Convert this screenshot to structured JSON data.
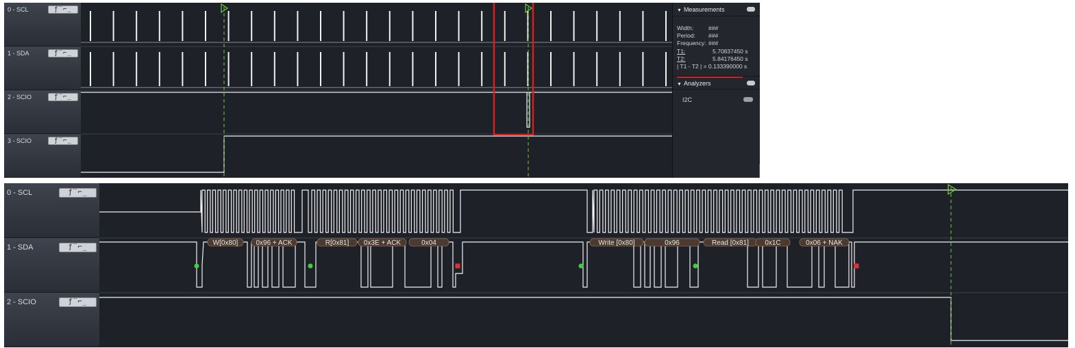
{
  "top": {
    "channels": [
      {
        "name": "0 - SCL",
        "controls": "ƒ‾⌐_"
      },
      {
        "name": "1 - SDA",
        "controls": "ƒ‾⌐_"
      },
      {
        "name": "2 - SCIO",
        "controls": "ƒ‾⌐_"
      },
      {
        "name": "3 - SCIO",
        "controls": "ƒ‾⌐_"
      }
    ]
  },
  "measurements": {
    "title": "Measurements",
    "rows": [
      {
        "key": "Width:",
        "value": "###"
      },
      {
        "key": "Period:",
        "value": "###"
      },
      {
        "key": "Frequency:",
        "value": "###"
      },
      {
        "key": "T1:",
        "value": "5.70837450 s"
      },
      {
        "key": "T2:",
        "value": "5.84176450 s"
      },
      {
        "key": "| T1 - T2 | = 0.133390000 s",
        "value": ""
      }
    ]
  },
  "analyzers": {
    "title": "Analyzers",
    "items": [
      {
        "label": "I2C"
      }
    ]
  },
  "bottom": {
    "channels": [
      {
        "name": "0 - SCL",
        "controls": "ƒ‾⌐_"
      },
      {
        "name": "1 - SDA",
        "controls": "ƒ‾⌐_"
      },
      {
        "name": "2 - SCIO",
        "controls": "ƒ‾⌐_"
      }
    ],
    "decodes": [
      {
        "text": "W[0x80]"
      },
      {
        "text": "0x96 + ACK"
      },
      {
        "text": "R[0x81]"
      },
      {
        "text": "0x3E + ACK"
      },
      {
        "text": "0x04"
      },
      {
        "text": "Write [0x80]"
      },
      {
        "text": "0x96"
      },
      {
        "text": "Read [0x81]"
      },
      {
        "text": "0x1C"
      },
      {
        "text": "0x06 + NAK"
      }
    ]
  },
  "colors": {
    "wave": "#f2f2f2",
    "marker": "#6fcf3f",
    "highlight": "#d32020",
    "start": "#3ecf3e",
    "stop": "#e03030"
  }
}
